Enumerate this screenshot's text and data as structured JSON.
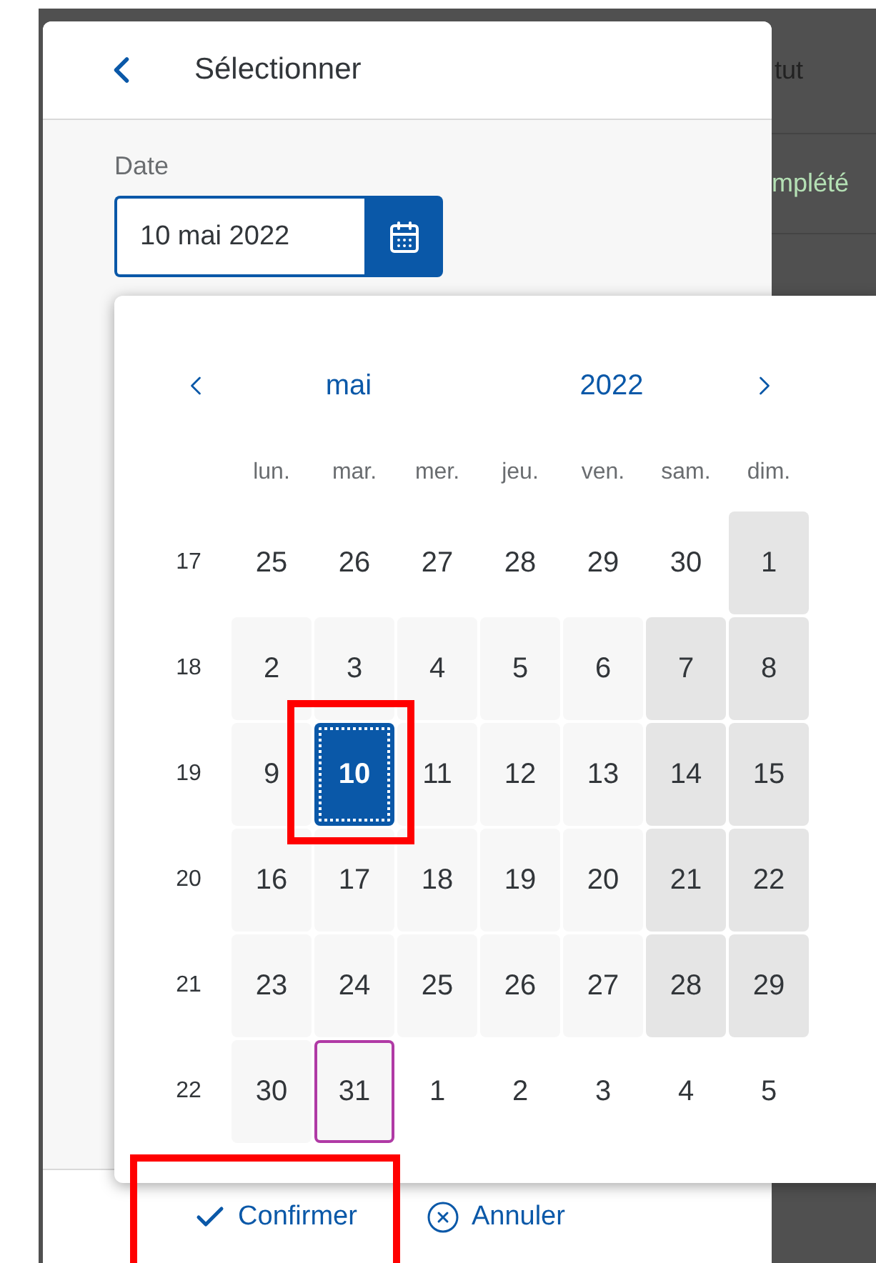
{
  "background_table": {
    "header": "tut",
    "cells": [
      "mplété"
    ]
  },
  "dialog": {
    "title": "Sélectionner",
    "field": {
      "label": "Date",
      "value": "10 mai 2022"
    },
    "calendar": {
      "month": "mai",
      "year": "2022",
      "weekdays": [
        "lun.",
        "mar.",
        "mer.",
        "jeu.",
        "ven.",
        "sam.",
        "dim."
      ],
      "weeks": [
        {
          "number": "17",
          "days": [
            {
              "text": "25",
              "kind": "other-month",
              "selected": false,
              "today": false,
              "annotated": false
            },
            {
              "text": "26",
              "kind": "other-month",
              "selected": false,
              "today": false,
              "annotated": false
            },
            {
              "text": "27",
              "kind": "other-month",
              "selected": false,
              "today": false,
              "annotated": false
            },
            {
              "text": "28",
              "kind": "other-month",
              "selected": false,
              "today": false,
              "annotated": false
            },
            {
              "text": "29",
              "kind": "other-month",
              "selected": false,
              "today": false,
              "annotated": false
            },
            {
              "text": "30",
              "kind": "other-month",
              "selected": false,
              "today": false,
              "annotated": false
            },
            {
              "text": "1",
              "kind": "weekend",
              "selected": false,
              "today": false,
              "annotated": false
            }
          ]
        },
        {
          "number": "18",
          "days": [
            {
              "text": "2",
              "kind": "weekday",
              "selected": false,
              "today": false,
              "annotated": false
            },
            {
              "text": "3",
              "kind": "weekday",
              "selected": false,
              "today": false,
              "annotated": false
            },
            {
              "text": "4",
              "kind": "weekday",
              "selected": false,
              "today": false,
              "annotated": false
            },
            {
              "text": "5",
              "kind": "weekday",
              "selected": false,
              "today": false,
              "annotated": false
            },
            {
              "text": "6",
              "kind": "weekday",
              "selected": false,
              "today": false,
              "annotated": false
            },
            {
              "text": "7",
              "kind": "weekend",
              "selected": false,
              "today": false,
              "annotated": false
            },
            {
              "text": "8",
              "kind": "weekend",
              "selected": false,
              "today": false,
              "annotated": false
            }
          ]
        },
        {
          "number": "19",
          "days": [
            {
              "text": "9",
              "kind": "weekday",
              "selected": false,
              "today": false,
              "annotated": false
            },
            {
              "text": "10",
              "kind": "weekday",
              "selected": true,
              "today": false,
              "annotated": true
            },
            {
              "text": "11",
              "kind": "weekday",
              "selected": false,
              "today": false,
              "annotated": false
            },
            {
              "text": "12",
              "kind": "weekday",
              "selected": false,
              "today": false,
              "annotated": false
            },
            {
              "text": "13",
              "kind": "weekday",
              "selected": false,
              "today": false,
              "annotated": false
            },
            {
              "text": "14",
              "kind": "weekend",
              "selected": false,
              "today": false,
              "annotated": false
            },
            {
              "text": "15",
              "kind": "weekend",
              "selected": false,
              "today": false,
              "annotated": false
            }
          ]
        },
        {
          "number": "20",
          "days": [
            {
              "text": "16",
              "kind": "weekday",
              "selected": false,
              "today": false,
              "annotated": false
            },
            {
              "text": "17",
              "kind": "weekday",
              "selected": false,
              "today": false,
              "annotated": false
            },
            {
              "text": "18",
              "kind": "weekday",
              "selected": false,
              "today": false,
              "annotated": false
            },
            {
              "text": "19",
              "kind": "weekday",
              "selected": false,
              "today": false,
              "annotated": false
            },
            {
              "text": "20",
              "kind": "weekday",
              "selected": false,
              "today": false,
              "annotated": false
            },
            {
              "text": "21",
              "kind": "weekend",
              "selected": false,
              "today": false,
              "annotated": false
            },
            {
              "text": "22",
              "kind": "weekend",
              "selected": false,
              "today": false,
              "annotated": false
            }
          ]
        },
        {
          "number": "21",
          "days": [
            {
              "text": "23",
              "kind": "weekday",
              "selected": false,
              "today": false,
              "annotated": false
            },
            {
              "text": "24",
              "kind": "weekday",
              "selected": false,
              "today": false,
              "annotated": false
            },
            {
              "text": "25",
              "kind": "weekday",
              "selected": false,
              "today": false,
              "annotated": false
            },
            {
              "text": "26",
              "kind": "weekday",
              "selected": false,
              "today": false,
              "annotated": false
            },
            {
              "text": "27",
              "kind": "weekday",
              "selected": false,
              "today": false,
              "annotated": false
            },
            {
              "text": "28",
              "kind": "weekend",
              "selected": false,
              "today": false,
              "annotated": false
            },
            {
              "text": "29",
              "kind": "weekend",
              "selected": false,
              "today": false,
              "annotated": false
            }
          ]
        },
        {
          "number": "22",
          "days": [
            {
              "text": "30",
              "kind": "weekday",
              "selected": false,
              "today": false,
              "annotated": false
            },
            {
              "text": "31",
              "kind": "weekday",
              "selected": false,
              "today": true,
              "annotated": false
            },
            {
              "text": "1",
              "kind": "other-month",
              "selected": false,
              "today": false,
              "annotated": false
            },
            {
              "text": "2",
              "kind": "other-month",
              "selected": false,
              "today": false,
              "annotated": false
            },
            {
              "text": "3",
              "kind": "other-month",
              "selected": false,
              "today": false,
              "annotated": false
            },
            {
              "text": "4",
              "kind": "other-month",
              "selected": false,
              "today": false,
              "annotated": false
            },
            {
              "text": "5",
              "kind": "other-month",
              "selected": false,
              "today": false,
              "annotated": false
            }
          ]
        }
      ]
    },
    "buttons": [
      {
        "label": "Confirmer",
        "kind": "confirm",
        "annotated": true
      },
      {
        "label": "Annuler",
        "kind": "cancel",
        "annotated": false
      }
    ]
  }
}
